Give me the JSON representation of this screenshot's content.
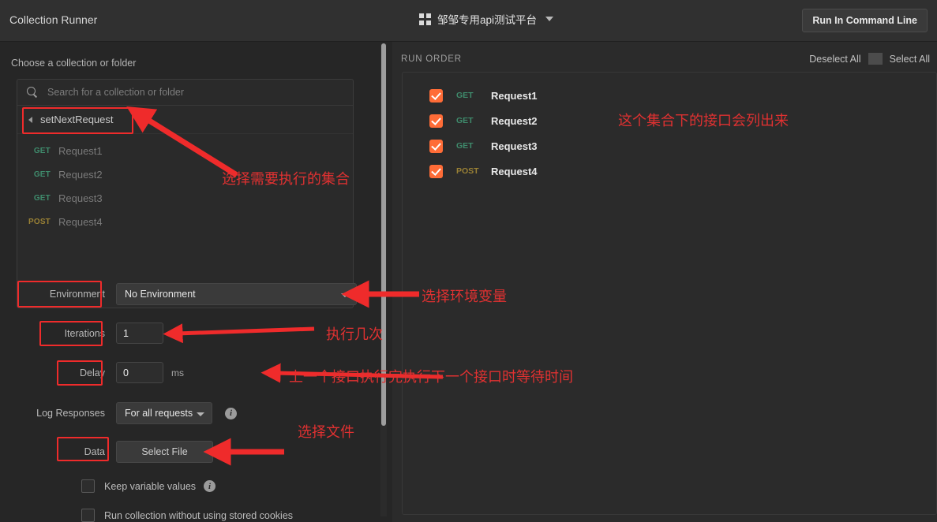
{
  "topbar": {
    "title": "Collection Runner",
    "workspace_name": "邹邹专用api测试平台",
    "grid_icon": "grid-icon",
    "caret_icon": "chevron-down-icon",
    "command_line_button": "Run In Command Line"
  },
  "left": {
    "section_label": "Choose a collection or folder",
    "search": {
      "placeholder": "Search for a collection or folder",
      "value": "",
      "icon": "search-icon"
    },
    "collection": {
      "name": "setNextRequest",
      "caret_icon": "chevron-left-icon"
    },
    "requests": [
      {
        "method": "GET",
        "name": "Request1"
      },
      {
        "method": "GET",
        "name": "Request2"
      },
      {
        "method": "GET",
        "name": "Request3"
      },
      {
        "method": "POST",
        "name": "Request4"
      }
    ],
    "environment": {
      "label": "Environment",
      "value": "No Environment",
      "caret_icon": "chevron-down-icon"
    },
    "iterations": {
      "label": "Iterations",
      "value": "1"
    },
    "delay": {
      "label": "Delay",
      "value": "0",
      "unit": "ms"
    },
    "log_responses": {
      "label": "Log Responses",
      "value": "For all requests",
      "caret_icon": "chevron-down-icon",
      "info_icon": "info-icon",
      "info_glyph": "i"
    },
    "data": {
      "label": "Data",
      "button": "Select File"
    },
    "keep_variable_values": {
      "label": "Keep variable values",
      "checked": false,
      "info_icon": "info-icon",
      "info_glyph": "i"
    },
    "no_cookies": {
      "label": "Run collection without using stored cookies",
      "checked": false
    }
  },
  "right": {
    "run_order_label": "RUN ORDER",
    "deselect_all": "Deselect All",
    "select_all": "Select All",
    "rows": [
      {
        "method": "GET",
        "name": "Request1",
        "checked": true
      },
      {
        "method": "GET",
        "name": "Request2",
        "checked": true
      },
      {
        "method": "GET",
        "name": "Request3",
        "checked": true
      },
      {
        "method": "POST",
        "name": "Request4",
        "checked": true
      }
    ]
  },
  "annotations": [
    {
      "id": "a1",
      "text": "这个集合下的接口会列出来"
    },
    {
      "id": "a2",
      "text": "选择需要执行的集合"
    },
    {
      "id": "a3",
      "text": "选择环境变量"
    },
    {
      "id": "a4",
      "text": "执行几次"
    },
    {
      "id": "a5",
      "text": "上一个接口执行完执行下一个接口时等待时间"
    },
    {
      "id": "a6",
      "text": "选择文件"
    }
  ],
  "colors": {
    "accent_orange": "#ff6c37",
    "annotation_red": "#e03131",
    "get_green": "#3f8b6c",
    "post_yellow": "#9a8135",
    "background": "#262626",
    "panel": "#2b2b2b"
  }
}
